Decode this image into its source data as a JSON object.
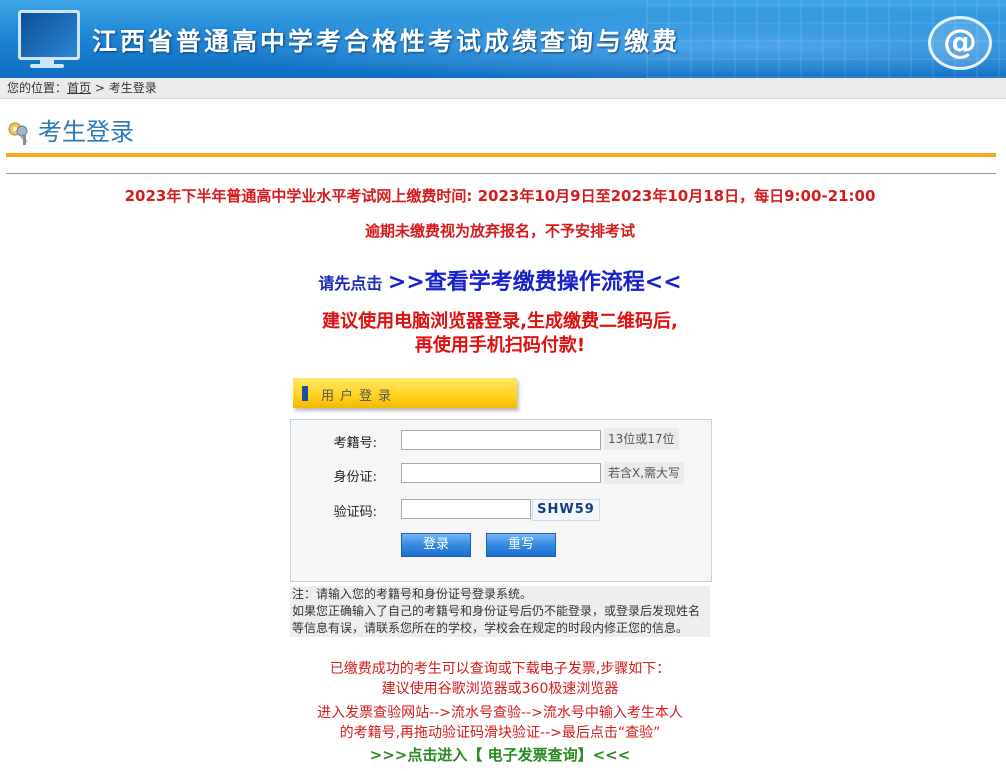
{
  "banner": {
    "title": "江西省普通高中学考合格性考试成绩查询与缴费"
  },
  "breadcrumb": {
    "prefix": "您的位置：",
    "home": "首页",
    "sep": " > ",
    "current": "考生登录"
  },
  "page": {
    "title": "考生登录"
  },
  "notices": {
    "line1": "2023年下半年普通高中学业水平考试网上缴费时间: 2023年10月9日至2023年10月18日，每日9:00-21:00",
    "line2": "逾期未缴费视为放弃报名，不予安排考试",
    "line3_prefix": "请先点击 ",
    "line3_link": ">>查看学考缴费操作流程<<",
    "line4a": "建议使用电脑浏览器登录,生成缴费二维码后,",
    "line4b": "再使用手机扫码付款!"
  },
  "login": {
    "tab_label": "用户登录",
    "exam_no_label": "考籍号:",
    "exam_no_value": "",
    "exam_no_hint": "13位或17位",
    "id_label": "身份证:",
    "id_value": "",
    "id_hint": "若含X,需大写",
    "code_label": "验证码:",
    "code_value": "",
    "captcha": "SHW59",
    "login_button": "登录",
    "reset_button": "重写"
  },
  "note": {
    "line1": "注：请输入您的考籍号和身份证号登录系统。",
    "line2": "如果您正确输入了自己的考籍号和身份证号后仍不能登录，或登录后发现姓名等信息有误，请联系您所在的学校，学校会在规定的时段内修正您的信息。"
  },
  "tips": {
    "line1": "已缴费成功的考生可以查询或下载电子发票,步骤如下：",
    "line2": "建议使用谷歌浏览器或360极速浏览器",
    "line3": "进入发票查验网站-->流水号查验-->流水号中输入考生本人",
    "line4": "的考籍号,再拖动验证码滑块验证-->最后点击“查验”",
    "invoice_link": ">>>点击进入【 电子发票查询】<<<"
  },
  "colors": {
    "accent_blue": "#2c78b9",
    "orange_rule": "#f5a623",
    "notice_red": "#d51b1b",
    "link_green": "#2a8a20"
  }
}
